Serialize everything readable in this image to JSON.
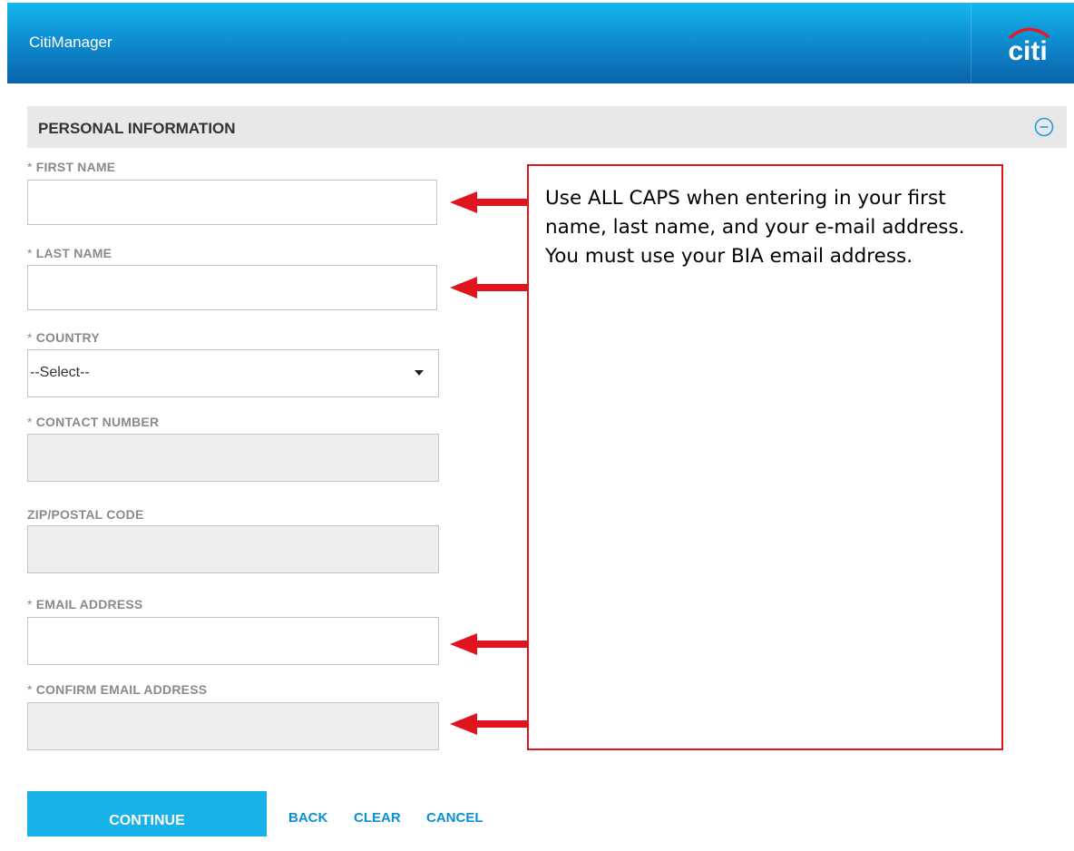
{
  "header": {
    "app_title": "CitiManager",
    "logo_text": "citi",
    "brand_colors": {
      "header_top": "#15b8ee",
      "header_bottom": "#0a63a8",
      "logo_arc": "#e31b23"
    }
  },
  "section": {
    "title": "PERSONAL INFORMATION",
    "collapse_icon": "minus-circle-icon"
  },
  "fields": {
    "first_name": {
      "required": "*",
      "label": "FIRST NAME",
      "value": ""
    },
    "last_name": {
      "required": "*",
      "label": "LAST NAME",
      "value": ""
    },
    "country": {
      "required": "*",
      "label": "COUNTRY",
      "selected": "--Select--"
    },
    "contact_number": {
      "required": "*",
      "label": "CONTACT NUMBER",
      "value": ""
    },
    "zip": {
      "label": "ZIP/POSTAL CODE",
      "value": ""
    },
    "email": {
      "required": "*",
      "label": "EMAIL ADDRESS",
      "value": ""
    },
    "confirm_email": {
      "required": "*",
      "label": "CONFIRM EMAIL ADDRESS",
      "value": ""
    }
  },
  "annotation": {
    "text": "Use ALL CAPS when entering in your first name, last name, and your e-mail address. You must use your BIA email address.",
    "color": "#e0141e"
  },
  "actions": {
    "continue_label": "CONTINUE",
    "back_label": "BACK",
    "clear_label": "CLEAR",
    "cancel_label": "CANCEL",
    "accent": "#19b2e8"
  }
}
